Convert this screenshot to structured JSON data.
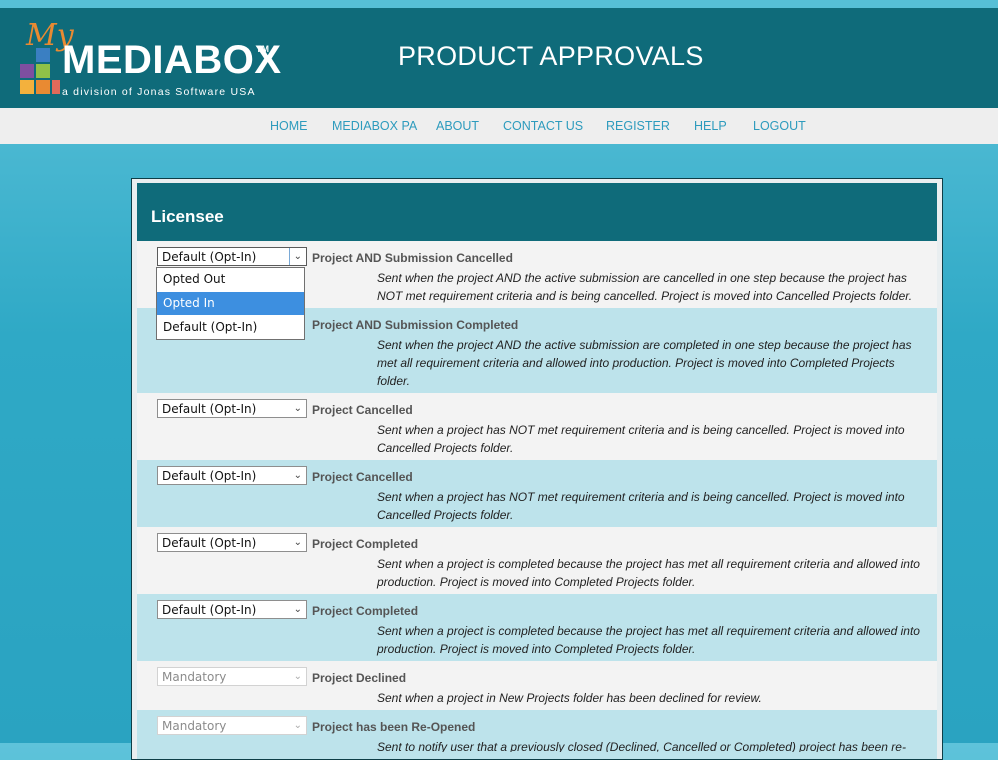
{
  "logo": {
    "my": "My",
    "brand": "MEDIABOX",
    "tm": "TM",
    "division": "a division of Jonas Software USA",
    "colors": [
      "#e98a32",
      "#f3b13d",
      "#3a7fc2",
      "#8fc148",
      "#7e4fa0",
      "#e16a5a"
    ]
  },
  "header": {
    "title": "PRODUCT APPROVALS"
  },
  "nav": [
    "HOME",
    "MEDIABOX PA",
    "ABOUT",
    "CONTACT US",
    "REGISTER",
    "HELP",
    "LOGOUT"
  ],
  "panel": {
    "title": "Licensee"
  },
  "rows": [
    {
      "select": "Default (Opt-In)",
      "title": "Project AND Submission Cancelled",
      "desc": "Sent when the project AND the active submission are cancelled in one step because the project has NOT met requirement criteria and is being cancelled. Project is moved into Cancelled Projects folder."
    },
    {
      "select": "",
      "title": "Project AND Submission Completed",
      "desc": "Sent when the project AND the active submission are completed in one step because the project has met all requirement criteria and allowed into production. Project is moved into Completed Projects folder."
    },
    {
      "select": "Default (Opt-In)",
      "title": "Project Cancelled",
      "desc": "Sent when a project has NOT met requirement criteria and is being cancelled. Project is moved into Cancelled Projects folder."
    },
    {
      "select": "Default (Opt-In)",
      "title": "Project Cancelled",
      "desc": "Sent when a project has NOT met requirement criteria and is being cancelled. Project is moved into Cancelled Projects folder."
    },
    {
      "select": "Default (Opt-In)",
      "title": "Project Completed",
      "desc": "Sent when a project is completed because the project has met all requirement criteria and allowed into production. Project is moved into Completed Projects folder."
    },
    {
      "select": "Default (Opt-In)",
      "title": "Project Completed",
      "desc": "Sent when a project is completed because the project has met all requirement criteria and allowed into production. Project is moved into Completed Projects folder."
    },
    {
      "select": "Mandatory",
      "title": "Project Declined",
      "desc": "Sent when a project in New Projects folder has been declined for review."
    },
    {
      "select": "Mandatory",
      "title": "Project has been Re-Opened",
      "desc": "Sent to notify user that a previously closed (Declined, Cancelled or Completed) project has been re-"
    }
  ],
  "dropdown": {
    "options": [
      "Opted Out",
      "Opted In",
      "Default (Opt-In)"
    ],
    "highlighted": "Opted In"
  }
}
